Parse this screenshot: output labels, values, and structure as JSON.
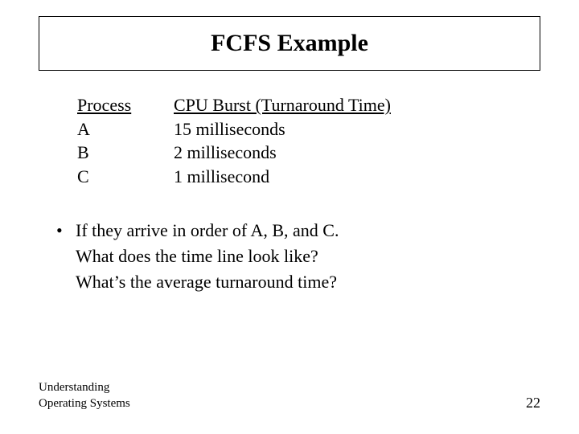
{
  "slide": {
    "title": "FCFS Example",
    "table": {
      "headers": {
        "c1": "Process",
        "c2": "CPU Burst (Turnaround Time)"
      },
      "rows": [
        {
          "c1": "A",
          "c2": "15 milliseconds"
        },
        {
          "c1": "B",
          "c2": "2 milliseconds"
        },
        {
          "c1": "C",
          "c2": "1 millisecond"
        }
      ]
    },
    "bullet": {
      "marker": "•",
      "line1": "If they arrive in order of A, B, and C.",
      "line2": "What does the time line look like?",
      "line3": "What’s the average turnaround time?"
    },
    "footer": {
      "source_line1": "Understanding",
      "source_line2": "Operating Systems",
      "page": "22"
    }
  }
}
